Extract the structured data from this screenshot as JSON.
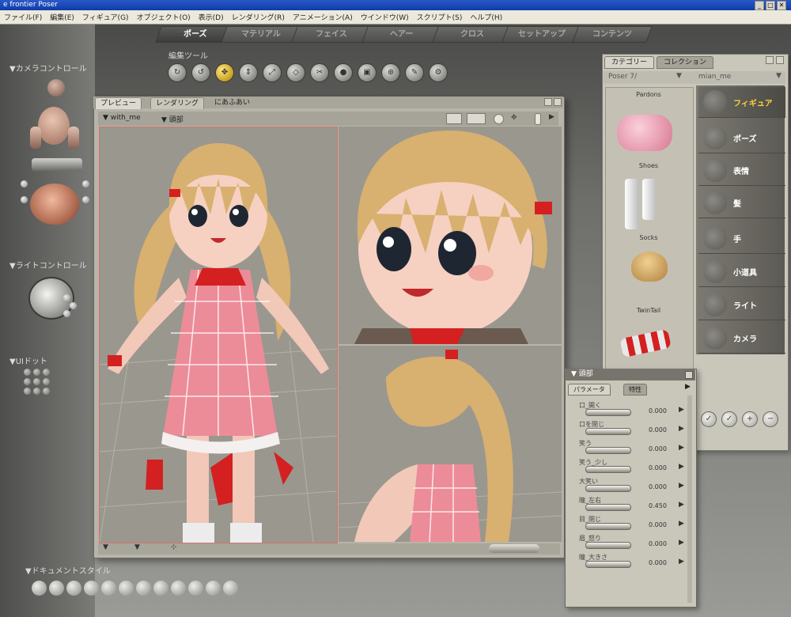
{
  "window": {
    "title": "e frontier Poser",
    "min": "_",
    "max": "□",
    "close": "✕"
  },
  "menu": [
    "ファイル(F)",
    "編集(E)",
    "フィギュア(G)",
    "オブジェクト(O)",
    "表示(D)",
    "レンダリング(R)",
    "アニメーション(A)",
    "ウインドウ(W)",
    "スクリプト(S)",
    "ヘルプ(H)"
  ],
  "rooms": [
    "ポーズ",
    "マテリアル",
    "フェイス",
    "ヘアー",
    "クロス",
    "セットアップ",
    "コンテンツ"
  ],
  "edit_tools": {
    "label": "編集ツール",
    "count": 12,
    "selected_index": 2
  },
  "left": {
    "camera_control": "▼カメラコントロール",
    "light_control": "▼ライトコントロール",
    "memory_dots": "▼UIドット",
    "document_style": "▼ドキュメントスタイル"
  },
  "preview": {
    "tabs": [
      "プレビュー",
      "レンダリング",
      "にあふあい"
    ],
    "figure_menu": "▼ with_me",
    "actor_menu": "▼ 頭部"
  },
  "library": {
    "tabs": [
      "カテゴリー",
      "コレクション"
    ],
    "left_select": "Poser 7/",
    "right_select": "mian_me",
    "section": "Pardons",
    "items": [
      "Shoes",
      "Socks",
      "TwinTail",
      ""
    ],
    "categories": [
      {
        "label": "フィギュア",
        "icon": "figure-icon"
      },
      {
        "label": "ポーズ",
        "icon": "pose-icon"
      },
      {
        "label": "表情",
        "icon": "expression-icon"
      },
      {
        "label": "髪",
        "icon": "hair-icon"
      },
      {
        "label": "手",
        "icon": "hand-icon"
      },
      {
        "label": "小道具",
        "icon": "props-icon"
      },
      {
        "label": "ライト",
        "icon": "light-icon"
      },
      {
        "label": "カメラ",
        "icon": "camera-icon"
      }
    ]
  },
  "params": {
    "title": "▼ 頭部",
    "tabs": [
      "パラメータ",
      "特性"
    ],
    "rows": [
      {
        "name": "口_開く",
        "value": "0.000"
      },
      {
        "name": "口を閉じ",
        "value": "0.000"
      },
      {
        "name": "笑う",
        "value": "0.000"
      },
      {
        "name": "笑う_少し",
        "value": "0.000"
      },
      {
        "name": "大笑い",
        "value": "0.000"
      },
      {
        "name": "瞳_左右",
        "value": "0.450"
      },
      {
        "name": "目_閉じ",
        "value": "0.000"
      },
      {
        "name": "眉_怒り",
        "value": "0.000"
      },
      {
        "name": "瞳_大きさ",
        "value": "0.000"
      }
    ]
  }
}
